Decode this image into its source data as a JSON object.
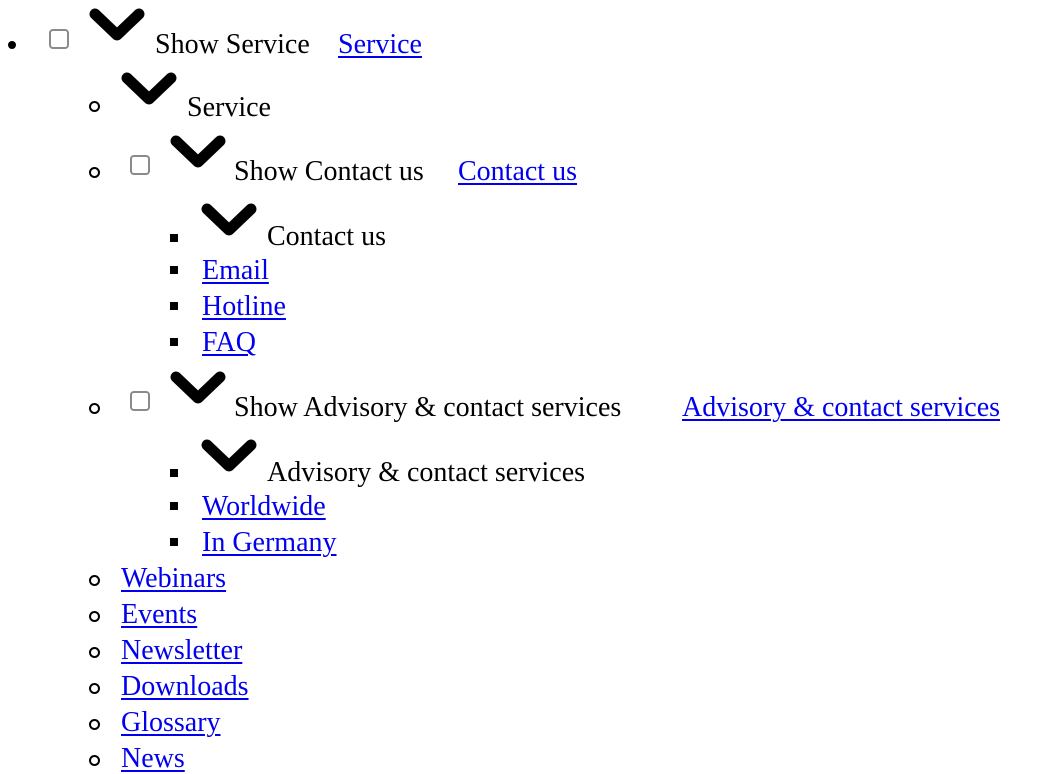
{
  "menu": {
    "service": {
      "show_label": "Show Service",
      "link_label": "Service",
      "heading_label": "Service",
      "contact": {
        "show_label": "Show Contact us",
        "link_label": "Contact us ",
        "heading_label": "Contact us",
        "items": [
          "Email",
          "Hotline",
          "FAQ"
        ]
      },
      "advisory": {
        "show_label": "Show Advisory & contact services",
        "link_label": "Advisory & contact services ",
        "heading_label": "Advisory & contact services",
        "items": [
          "Worldwide",
          "In Germany"
        ]
      },
      "links": [
        "Webinars ",
        "Events ",
        "Newsletter ",
        "Downloads ",
        "Glossary ",
        "News "
      ]
    }
  },
  "icons": {
    "chevron": "chevron-down-icon",
    "checkbox": "checkbox-icon"
  },
  "colors": {
    "link": "#0000ee",
    "text": "#000000",
    "checkbox_border": "#8a8a8a"
  }
}
